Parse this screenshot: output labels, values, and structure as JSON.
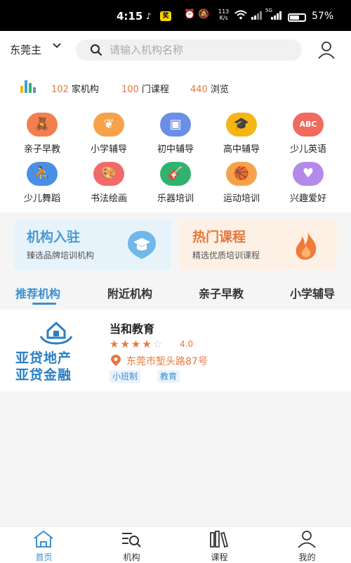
{
  "status_bar": {
    "time": "4:15",
    "app_badge": "奖",
    "net_speed_value": "113",
    "net_speed_unit": "K/s",
    "network_label": "5G",
    "battery_percent": "57%",
    "battery_level": 0.57
  },
  "header": {
    "city": "东莞主",
    "search_placeholder": "请输入机构名称"
  },
  "stats": [
    {
      "num": "102",
      "label": "家机构"
    },
    {
      "num": "100",
      "label": "门课程"
    },
    {
      "num": "440",
      "label": "浏览"
    }
  ],
  "categories": [
    {
      "label": "亲子早教",
      "icon": "teddy-bear-icon",
      "color": "#f2804e"
    },
    {
      "label": "小学辅导",
      "icon": "sprout-icon",
      "color": "#f7a24b"
    },
    {
      "label": "初中辅导",
      "icon": "board-icon",
      "color": "#6b8fe6"
    },
    {
      "label": "高中辅导",
      "icon": "graduation-cap-icon",
      "color": "#f5b515"
    },
    {
      "label": "少儿英语",
      "icon": "abc-blocks-icon",
      "color": "#f06a5e"
    },
    {
      "label": "少儿舞蹈",
      "icon": "dancer-icon",
      "color": "#4a8fe6"
    },
    {
      "label": "书法绘画",
      "icon": "palette-icon",
      "color": "#f06a6a"
    },
    {
      "label": "乐器培训",
      "icon": "guitar-icon",
      "color": "#2fb36e"
    },
    {
      "label": "运动培训",
      "icon": "basketball-icon",
      "color": "#f7a24b"
    },
    {
      "label": "兴趣爱好",
      "icon": "heart-icon",
      "color": "#b48ae8"
    }
  ],
  "banners": [
    {
      "title": "机构入驻",
      "subtitle": "臻选品牌培训机构",
      "icon": "graduation-cap-badge-icon"
    },
    {
      "title": "热门课程",
      "subtitle": "精选优质培训课程",
      "icon": "flame-icon"
    }
  ],
  "tabs": [
    "推荐机构",
    "附近机构",
    "亲子早教",
    "小学辅导"
  ],
  "institution": {
    "name": "当和教育",
    "logo_line1": "亚贷地产",
    "logo_line2": "亚贷金融",
    "rating": "4.0",
    "rating_value": 4,
    "rating_max": 5,
    "address": "东莞市堑头路87号",
    "tags": [
      "小班制",
      "教育"
    ]
  },
  "bottom_nav": [
    {
      "label": "首页",
      "icon": "home-icon",
      "active": true
    },
    {
      "label": "机构",
      "icon": "institution-list-icon",
      "active": false
    },
    {
      "label": "课程",
      "icon": "books-icon",
      "active": false
    },
    {
      "label": "我的",
      "icon": "profile-icon",
      "active": false
    }
  ],
  "colors": {
    "accent_blue": "#3b8fd0",
    "accent_orange": "#e8773a"
  }
}
